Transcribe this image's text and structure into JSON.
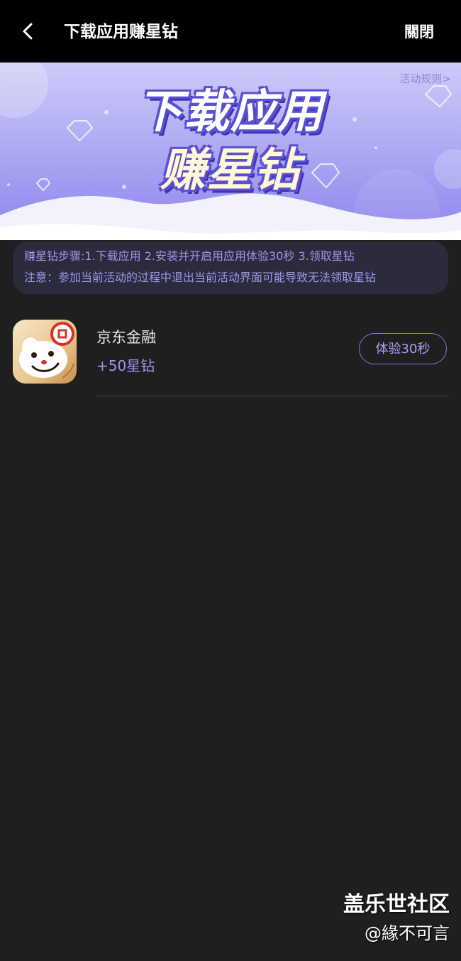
{
  "header": {
    "title": "下载应用赚星钻",
    "close_label": "關閉"
  },
  "banner": {
    "title_line1": "下载应用",
    "title_line2": "赚星钻",
    "rules_link": "活动规则>"
  },
  "notice": {
    "steps": "赚星钻步骤:1.下载应用 2.安装并开启用应用体验30秒 3.领取星钻",
    "warning": "注意：参加当前活动的过程中退出当前活动界面可能导致无法领取星钻"
  },
  "apps": [
    {
      "name": "京东金融",
      "reward": "+50星钻",
      "button_label": "体验30秒"
    }
  ],
  "watermark": {
    "community": "盖乐世社区",
    "user": "@緣不可言"
  },
  "colors": {
    "accent": "#9c96ef",
    "background": "#1f1f20",
    "header": "#000000"
  }
}
